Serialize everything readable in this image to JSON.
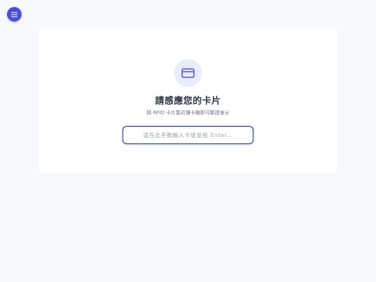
{
  "menu": {
    "icon": "hamburger-menu-icon",
    "color": "#4a4fd6"
  },
  "card": {
    "icon": "credit-card-icon",
    "title": "請感應您的卡片",
    "subtitle": "將 RFID 卡片靠近讀卡機即可驗證身分",
    "input": {
      "value": "",
      "placeholder": "或在此手動輸入卡號並按 Enter..."
    }
  },
  "colors": {
    "accent": "#4a4fd6",
    "input_border": "#2b2f6e",
    "icon_bg": "#e9ecfb",
    "background": "#f8f9fc"
  }
}
